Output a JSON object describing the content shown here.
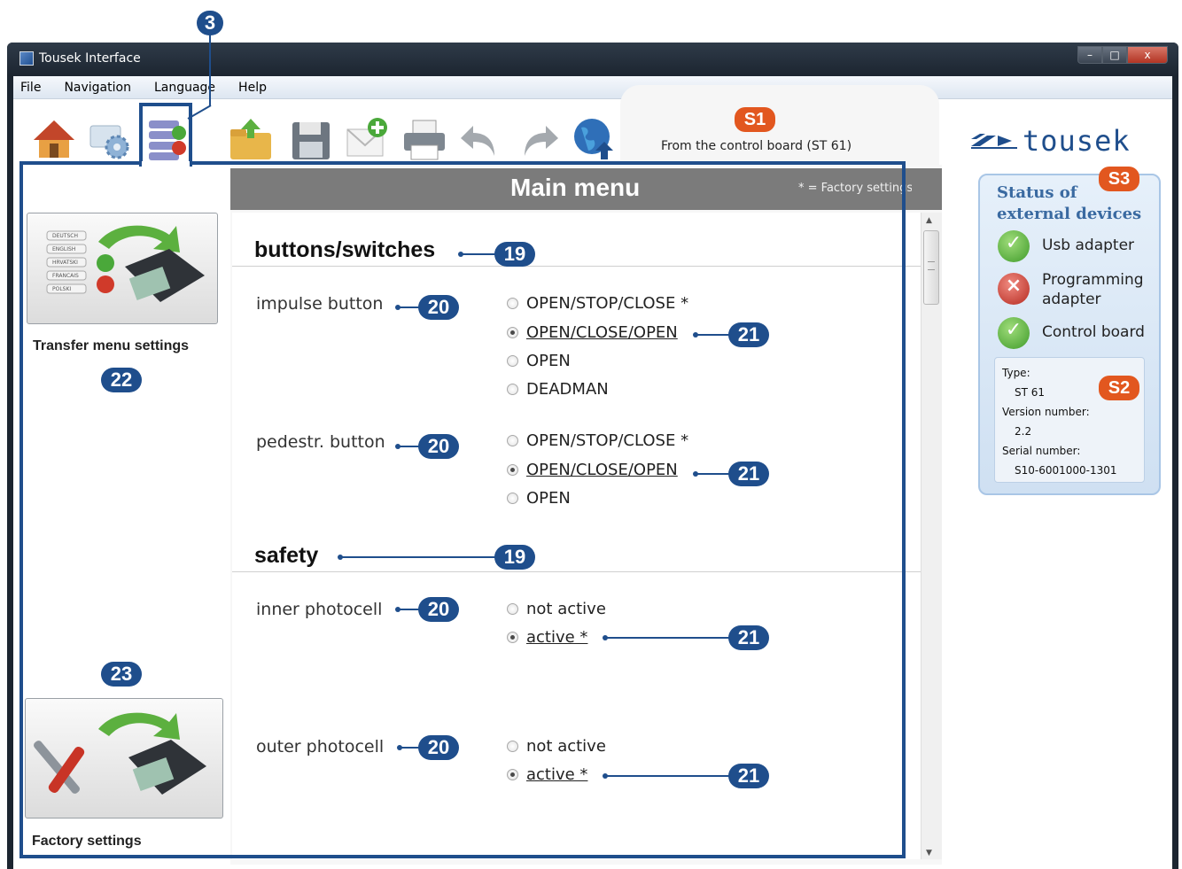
{
  "window": {
    "title": "Tousek Interface",
    "controls": {
      "minimize": "–",
      "maximize": "□",
      "close": "x"
    }
  },
  "menu": [
    "File",
    "Navigation",
    "Language",
    "Help"
  ],
  "toolbar": {
    "left_icons": [
      "home-icon",
      "settings-icon",
      "menu-list-icon"
    ],
    "icons": [
      "open-folder-icon",
      "save-icon",
      "new-mail-icon",
      "print-icon",
      "undo-icon",
      "redo-icon",
      "globe-icon"
    ]
  },
  "source_text": "From the control board (ST 61)",
  "sidebar": {
    "transfer_label": "Transfer menu settings",
    "factory_label": "Factory settings",
    "transfer_list": [
      "DEUTSCH",
      "ENGLISH",
      "HRVATSKI",
      "FRANCAIS",
      "POLSKI"
    ]
  },
  "main": {
    "title": "Main menu",
    "factory_note": "* = Factory settings",
    "sections": [
      {
        "title": "buttons/switches",
        "settings": [
          {
            "label": "impulse button",
            "options": [
              "OPEN/STOP/CLOSE *",
              "OPEN/CLOSE/OPEN",
              "OPEN",
              "DEADMAN"
            ],
            "selected": 1
          },
          {
            "label": "pedestr. button",
            "options": [
              "OPEN/STOP/CLOSE *",
              "OPEN/CLOSE/OPEN",
              "OPEN"
            ],
            "selected": 1
          }
        ]
      },
      {
        "title": "safety",
        "settings": [
          {
            "label": "inner photocell",
            "options": [
              "not active",
              "active *"
            ],
            "selected": 1
          },
          {
            "label": "outer photocell",
            "options": [
              "not active",
              "active *"
            ],
            "selected": 1
          }
        ]
      }
    ]
  },
  "brand": {
    "logo_text": "tousek",
    "color": "#1f4e8c"
  },
  "status": {
    "title": "Status of external devices",
    "devices": [
      {
        "name": "Usb adapter",
        "state": "ok"
      },
      {
        "name": "Programming adapter",
        "state": "error"
      },
      {
        "name": "Control board",
        "state": "ok"
      }
    ],
    "info": {
      "type_label": "Type:",
      "type": "ST 61",
      "version_label": "Version number:",
      "version": "2.2",
      "serial_label": "Serial number:",
      "serial": "S10-6001000-1301"
    }
  },
  "annotations": {
    "b3": "3",
    "b19": "19",
    "b20": "20",
    "b21": "21",
    "b22": "22",
    "b23": "23",
    "s1": "S1",
    "s2": "S2",
    "s3": "S3"
  },
  "colors": {
    "annotation_blue": "#1f4e8c",
    "annotation_orange": "#e2571f",
    "header_gray": "#7b7b7b"
  }
}
